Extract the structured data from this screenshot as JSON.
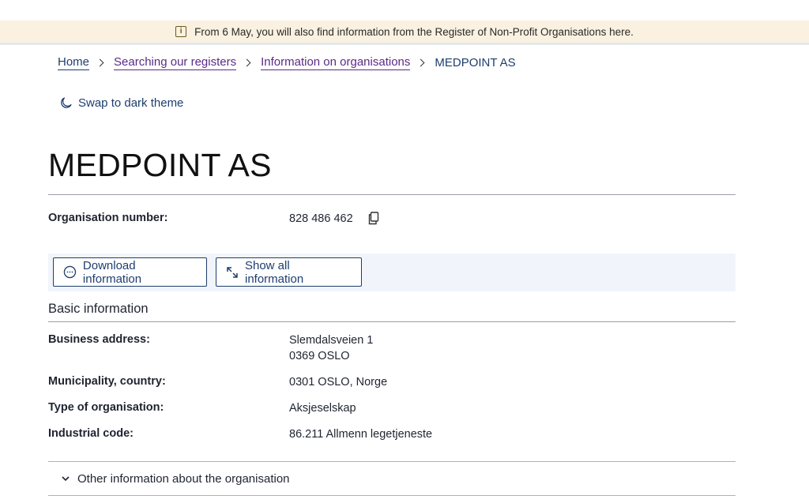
{
  "banner": {
    "icon": "info-icon",
    "text": "From 6 May, you will also find information from the Register of Non-Profit Organisations here."
  },
  "breadcrumb": {
    "items": [
      "Home",
      "Searching our registers",
      "Information on organisations"
    ],
    "current": "MEDPOINT AS"
  },
  "theme_toggle": {
    "icon": "moon-icon",
    "label": "Swap to dark theme"
  },
  "page": {
    "title": "MEDPOINT AS"
  },
  "org_number": {
    "label": "Organisation number:",
    "value": "828 486 462",
    "copy_icon": "copy-icon"
  },
  "actions": {
    "download": {
      "label": "Download information",
      "icon": "ellipsis-circle-icon"
    },
    "show_all": {
      "label": "Show all information",
      "icon": "expand-icon"
    }
  },
  "basic_info": {
    "heading": "Basic information",
    "rows": [
      {
        "label": "Business address:",
        "value_lines": [
          "Slemdalsveien 1",
          "0369 OSLO"
        ]
      },
      {
        "label": "Municipality, country:",
        "value_lines": [
          "0301 OSLO, Norge"
        ]
      },
      {
        "label": "Type of organisation:",
        "value_lines": [
          "Aksjeselskap"
        ]
      },
      {
        "label": "Industrial code:",
        "value_lines": [
          "86.211 Allmenn legetjeneste"
        ]
      }
    ]
  },
  "other_info": {
    "label": "Other information about the organisation",
    "icon": "chevron-down-icon"
  },
  "colors": {
    "banner_bg": "#faf1e0",
    "link_visited": "#5b2a86",
    "primary": "#1d3e6e",
    "action_bar_bg": "#f1f5fb"
  }
}
